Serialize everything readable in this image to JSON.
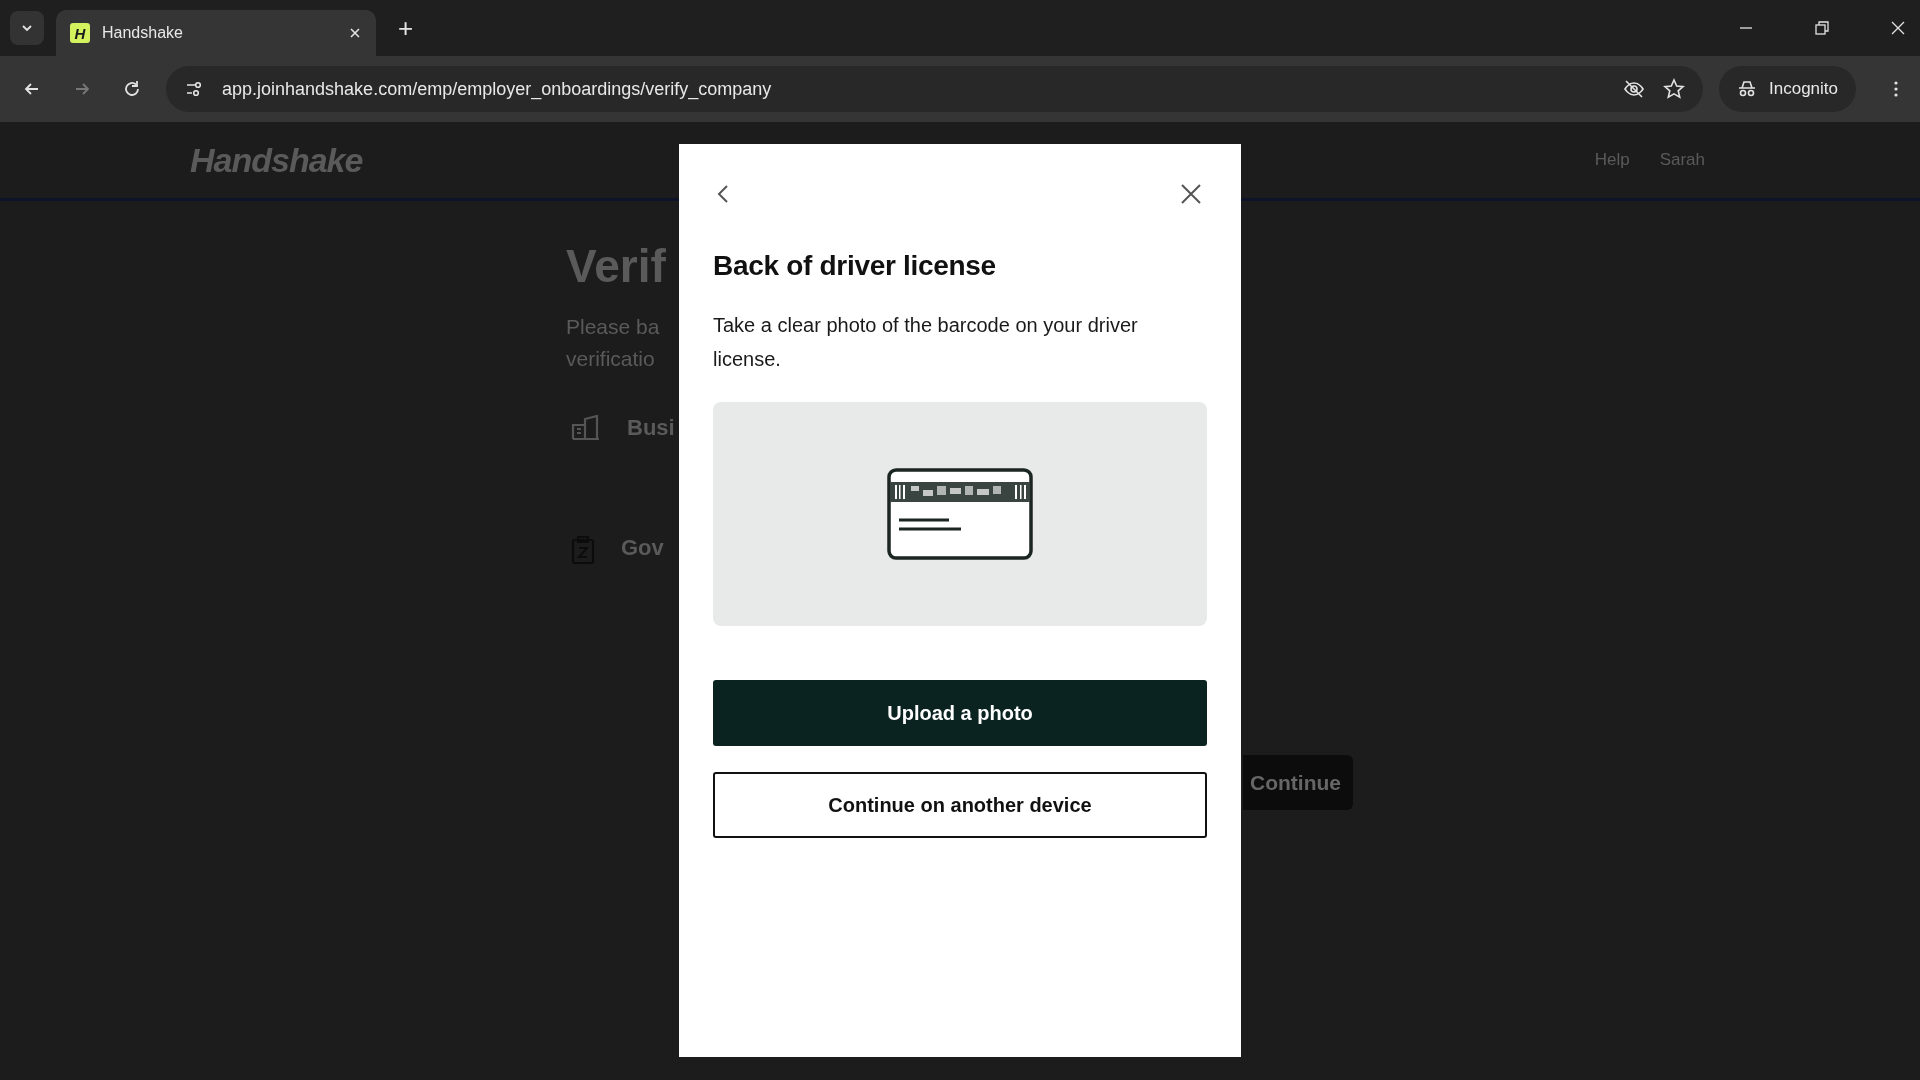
{
  "browser": {
    "tab": {
      "title": "Handshake",
      "favicon": "H"
    },
    "new_tab": "+",
    "url": "app.joinhandshake.com/emp/employer_onboardings/verify_company",
    "profile": "Incognito"
  },
  "page": {
    "logo": "Handshake",
    "nav": [
      "Help",
      "Sarah"
    ],
    "heading": "Verif",
    "intro_lines": [
      "Please ba",
      "verificatio"
    ],
    "options": [
      {
        "label": "Busi",
        "kind": "building"
      },
      {
        "label": "Gov",
        "kind": "clipboard"
      }
    ],
    "continue": "Continue"
  },
  "modal": {
    "title": "Back of driver license",
    "description": "Take a clear photo of the barcode on your driver license.",
    "buttons": [
      {
        "label": "Upload a photo",
        "kind": "primary"
      },
      {
        "label": "Continue on another device",
        "kind": "secondary"
      }
    ]
  }
}
